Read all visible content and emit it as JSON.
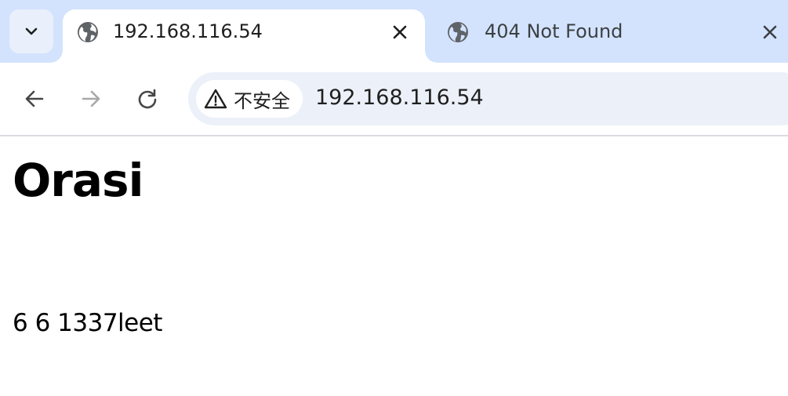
{
  "browser": {
    "tabs": [
      {
        "title": "192.168.116.54",
        "active": true
      },
      {
        "title": "404 Not Found",
        "active": false
      }
    ],
    "address_bar": {
      "security_label": "不安全",
      "url": "192.168.116.54"
    }
  },
  "page": {
    "heading": "Orasi",
    "text": "6 6 1337leet"
  },
  "icons": {
    "tab_search": "chevron-down-icon",
    "favicon": "globe-icon",
    "close": "close-icon",
    "back": "arrow-left-icon",
    "forward": "arrow-right-icon",
    "reload": "reload-icon",
    "security": "warning-triangle-icon"
  },
  "colors": {
    "tabstrip_bg": "#d3e3fd",
    "omnibox_bg": "#ecf1f9",
    "icon_dark": "#474747",
    "icon_disabled": "#a8a8a8"
  }
}
